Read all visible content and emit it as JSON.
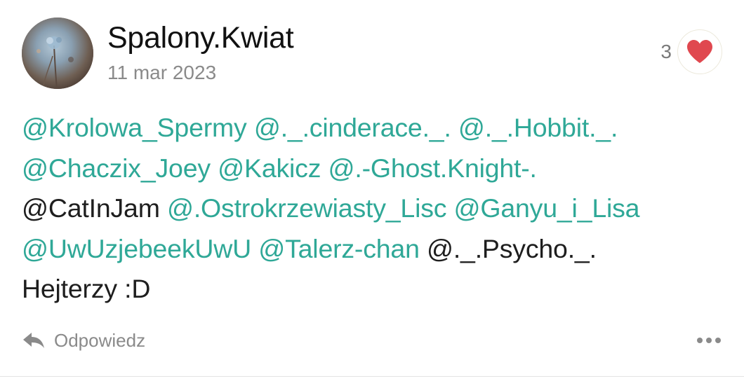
{
  "comment": {
    "username": "Spalony.Kwiat",
    "date": "11 mar 2023",
    "like_count": "3",
    "avatar_icon": "avatar-photo",
    "heart_icon": "heart-icon",
    "heart_color": "#e0484f",
    "mention_color": "#2fa897",
    "lines": [
      [
        {
          "text": "@Krolowa_Spermy",
          "type": "mention"
        },
        {
          "text": " ",
          "type": "plain"
        },
        {
          "text": "@._.cinderace._.",
          "type": "mention"
        },
        {
          "text": " ",
          "type": "plain"
        },
        {
          "text": "@._.Hobbit._.",
          "type": "mention"
        }
      ],
      [
        {
          "text": "@Chaczix_Joey",
          "type": "mention"
        },
        {
          "text": " ",
          "type": "plain"
        },
        {
          "text": "@Kakicz",
          "type": "mention"
        },
        {
          "text": " ",
          "type": "plain"
        },
        {
          "text": "@.-Ghost.Knight-.",
          "type": "mention"
        }
      ],
      [
        {
          "text": "@CatInJam",
          "type": "plain"
        },
        {
          "text": " ",
          "type": "plain"
        },
        {
          "text": "@.Ostrokrzewiasty_Lisc",
          "type": "mention"
        },
        {
          "text": " ",
          "type": "plain"
        },
        {
          "text": "@Ganyu_i_Lisa",
          "type": "mention"
        }
      ],
      [
        {
          "text": "@UwUzjebeekUwU",
          "type": "mention"
        },
        {
          "text": " ",
          "type": "plain"
        },
        {
          "text": "@Talerz-chan",
          "type": "mention"
        },
        {
          "text": " ",
          "type": "plain"
        },
        {
          "text": "@._.Psycho._.",
          "type": "plain"
        }
      ],
      [
        {
          "text": "Hejterzy :D",
          "type": "plain"
        }
      ]
    ],
    "actions": {
      "reply_label": "Odpowiedz",
      "reply_icon": "reply-arrow-icon",
      "more_icon": "more-dots-icon"
    }
  }
}
